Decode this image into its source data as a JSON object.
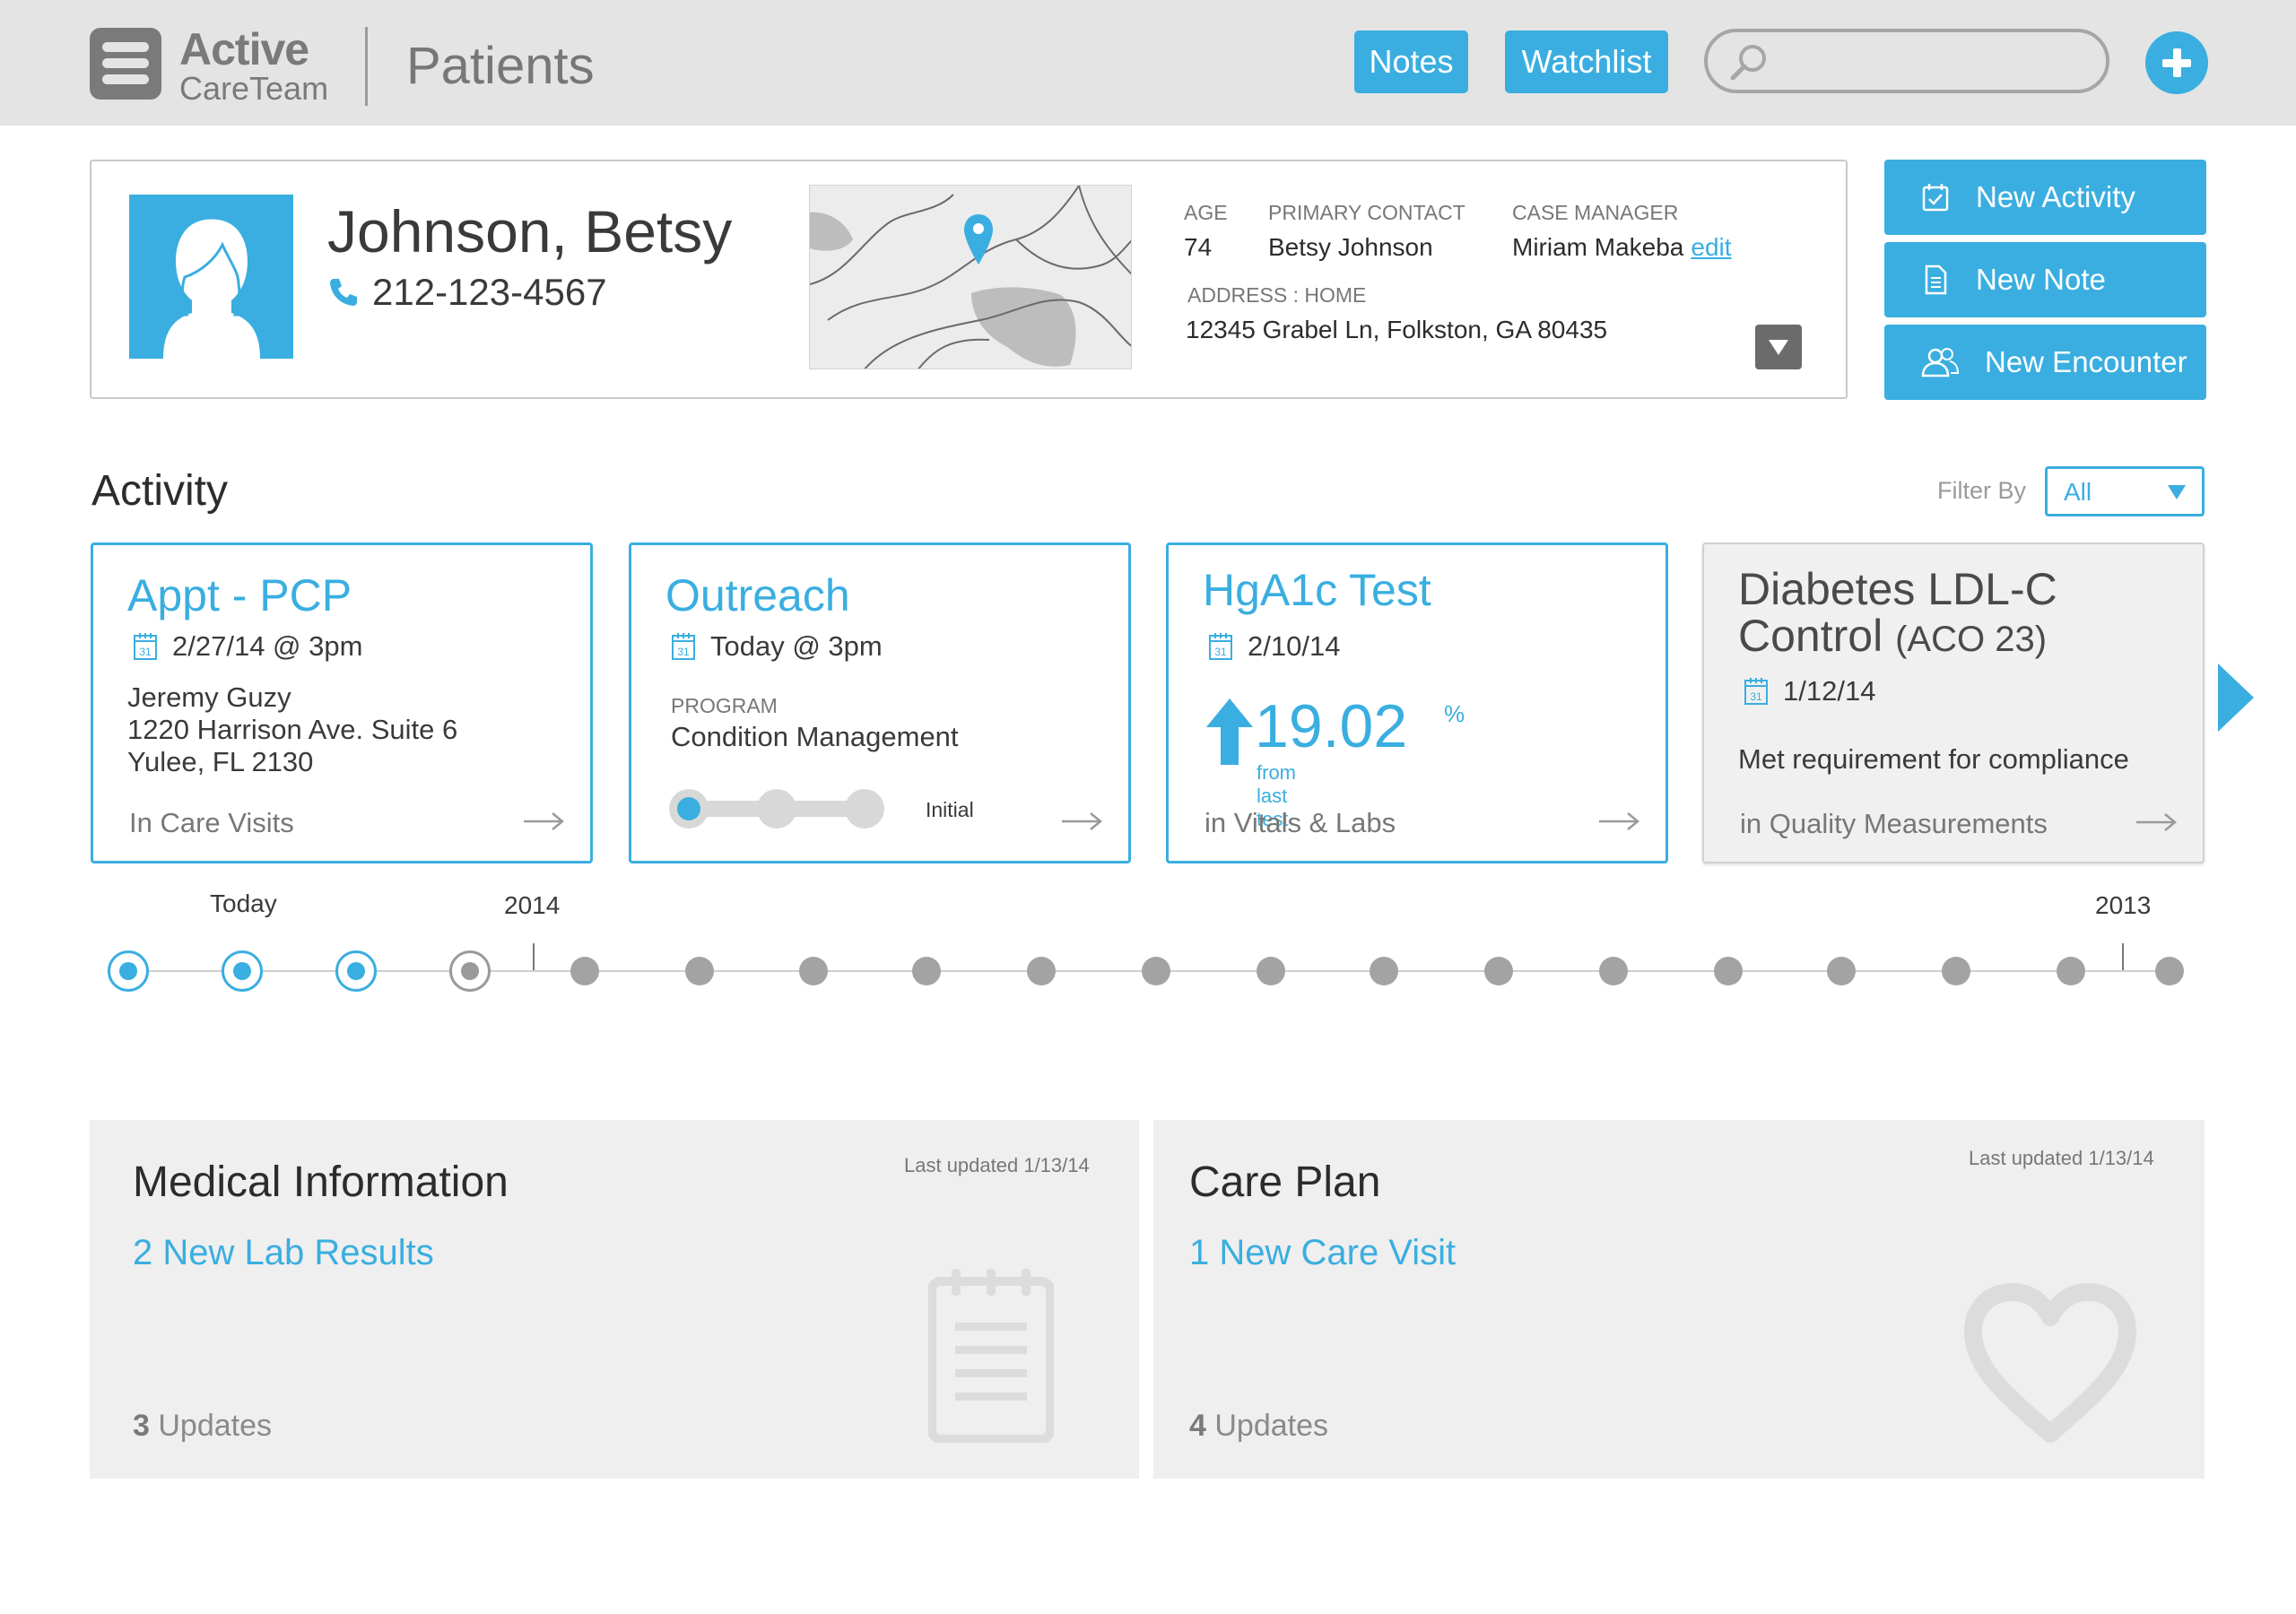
{
  "app": {
    "logo_line1": "Active",
    "logo_line2": "CareTeam",
    "page_title": "Patients"
  },
  "header": {
    "notes_label": "Notes",
    "watchlist_label": "Watchlist",
    "search_placeholder": "",
    "add_icon": "plus-icon"
  },
  "patient": {
    "name": "Johnson, Betsy",
    "phone": "212-123-4567",
    "age_label": "AGE",
    "age": "74",
    "primary_contact_label": "PRIMARY CONTACT",
    "primary_contact": "Betsy Johnson",
    "case_manager_label": "CASE MANAGER",
    "case_manager": "Miriam Makeba",
    "edit_label": "edit",
    "address_label": "ADDRESS : HOME",
    "address": "12345 Grabel Ln,  Folkston, GA 80435"
  },
  "actions": {
    "new_activity": "New Activity",
    "new_note": "New Note",
    "new_encounter": "New Encounter"
  },
  "activity": {
    "title": "Activity",
    "filter_label": "Filter By",
    "filter_value": "All",
    "cards": [
      {
        "title": "Appt - PCP",
        "date": "2/27/14 @ 3pm",
        "line1": "Jeremy Guzy",
        "line2": "1220 Harrison Ave. Suite 6",
        "line3": "Yulee, FL 2130",
        "footer": "In Care Visits"
      },
      {
        "title": "Outreach",
        "date": "Today @ 3pm",
        "program_label": "PROGRAM",
        "program": "Condition Management",
        "step_label": "Initial",
        "step_current": 1,
        "step_total": 3
      },
      {
        "title": "HgA1c Test",
        "date": "2/10/14",
        "metric": "19.02",
        "metric_unit": "%",
        "metric_sub": "from last test",
        "footer": "in Vitals & Labs"
      },
      {
        "title_main": "Diabetes LDL-C",
        "title_line2": "Control",
        "title_sub": "(ACO 23)",
        "date": "1/12/14",
        "body": "Met requirement for compliance",
        "footer": "in Quality Measurements"
      }
    ]
  },
  "timeline": {
    "label_today": "Today",
    "label_2014": "2014",
    "label_2013": "2013",
    "nodes": [
      "active",
      "active",
      "active",
      "hollow",
      "dot",
      "dot",
      "dot",
      "dot",
      "dot",
      "dot",
      "dot",
      "dot",
      "dot",
      "dot",
      "dot",
      "dot",
      "dot",
      "dot",
      "dot"
    ]
  },
  "panels": {
    "medical": {
      "title": "Medical Information",
      "updated": "Last updated 1/13/14",
      "link": "2 New Lab Results",
      "count": "3",
      "count_label": " Updates",
      "icon": "clipboard-icon"
    },
    "careplan": {
      "title": "Care Plan",
      "updated": "Last updated 1/13/14",
      "link": "1 New Care Visit",
      "count": "4",
      "count_label": " Updates",
      "icon": "heart-icon"
    }
  },
  "colors": {
    "accent": "#3aaee0",
    "header_bg": "#e4e4e4",
    "panel_bg": "#efefef"
  }
}
